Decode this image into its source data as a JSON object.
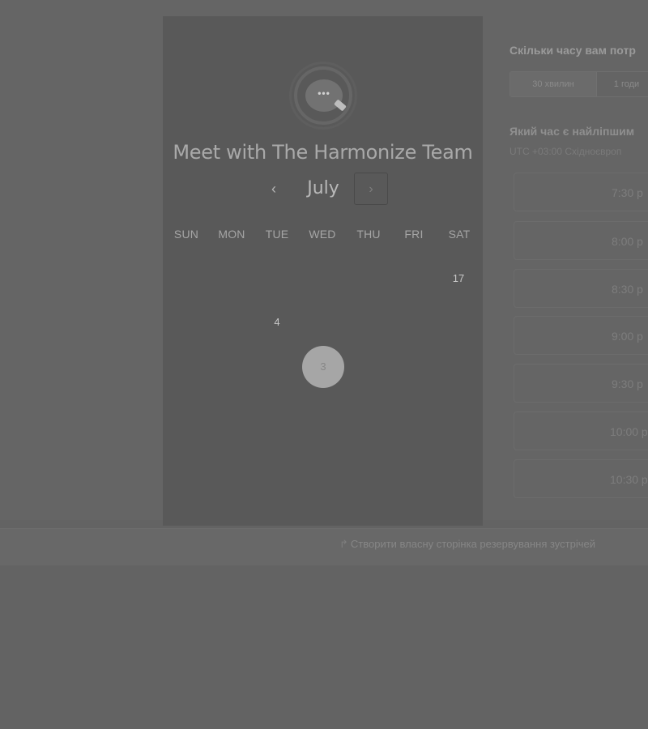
{
  "card": {
    "title": "Meet with The Harmonize Team",
    "month": "July",
    "weekdays": [
      "SUN",
      "MON",
      "TUE",
      "WED",
      "THU",
      "FRI",
      "SAT"
    ],
    "days": [
      "17",
      "4"
    ],
    "selected_day": "3",
    "prev_icon": "‹",
    "next_icon": "›",
    "logo_dots": "•••"
  },
  "panel": {
    "duration_question": "Скільки часу вам потр",
    "durations": [
      "30 хвилин",
      "1 годи"
    ],
    "time_question": "Який час є найліпшим",
    "timezone": "UTC +03:00 Східноєвроп",
    "slots": [
      "7:30 p",
      "8:00 p",
      "8:30 p",
      "9:00 p",
      "9:30 p",
      "10:00 p",
      "10:30 p"
    ]
  },
  "footer": {
    "link_label": "Створити власну сторінка резервування зустрічей",
    "link_icon": "↱"
  },
  "colors": {
    "overlay": "#636363",
    "card": "#595959",
    "selected_day": "#a6a6a6"
  }
}
